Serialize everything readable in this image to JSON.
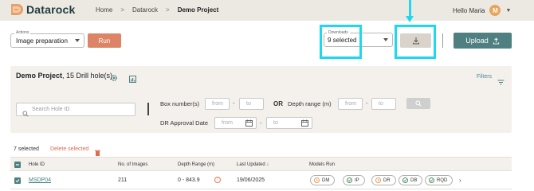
{
  "brand": {
    "name": "Datarock"
  },
  "breadcrumb": {
    "home": "Home",
    "sep": ">",
    "level1": "Datarock",
    "current": "Demo Project"
  },
  "user": {
    "greeting": "Hello Maria",
    "initial": "M"
  },
  "toolbar": {
    "actions_label": "Actions",
    "actions_value": "Image preparation",
    "run_label": "Run",
    "downloads_label": "Downloads",
    "downloads_value": "9 selected",
    "upload_label": "Upload"
  },
  "project": {
    "name": "Demo Project",
    "drill_holes": ", 15 Drill hole(s)",
    "filters_label": "Filters"
  },
  "filters": {
    "search_placeholder": "Search Hole ID",
    "box_number_label": "Box number(s)",
    "from_placeholder": "from",
    "to_placeholder": "to",
    "dash": "-",
    "or_label": "OR",
    "depth_range_label": "Depth range (m)",
    "dr_approval_label": "DR Approval Date"
  },
  "selection": {
    "count_text": "7 selected",
    "delete_label": "Delete selected"
  },
  "table": {
    "headers": {
      "hole_id": "Hole ID",
      "images": "No. of Images",
      "depth": "Depth Range (m)",
      "updated": "Last Updated",
      "models": "Models Run"
    },
    "rows": [
      {
        "hole_id": "MSDP04",
        "images": "211",
        "depth": "0 - 843.9",
        "updated": "19/06/2025",
        "models": [
          {
            "label": "DM",
            "status": "pending"
          },
          {
            "label": "IP",
            "status": "done"
          },
          {
            "label": "DR",
            "status": "pending"
          },
          {
            "label": "DB",
            "status": "done"
          },
          {
            "label": "RQD",
            "status": "done"
          }
        ]
      }
    ]
  },
  "colors": {
    "primary": "#4f7f80",
    "accent": "#dd8466",
    "highlight": "#1fd7ef",
    "panel": "#f4f1ed"
  }
}
